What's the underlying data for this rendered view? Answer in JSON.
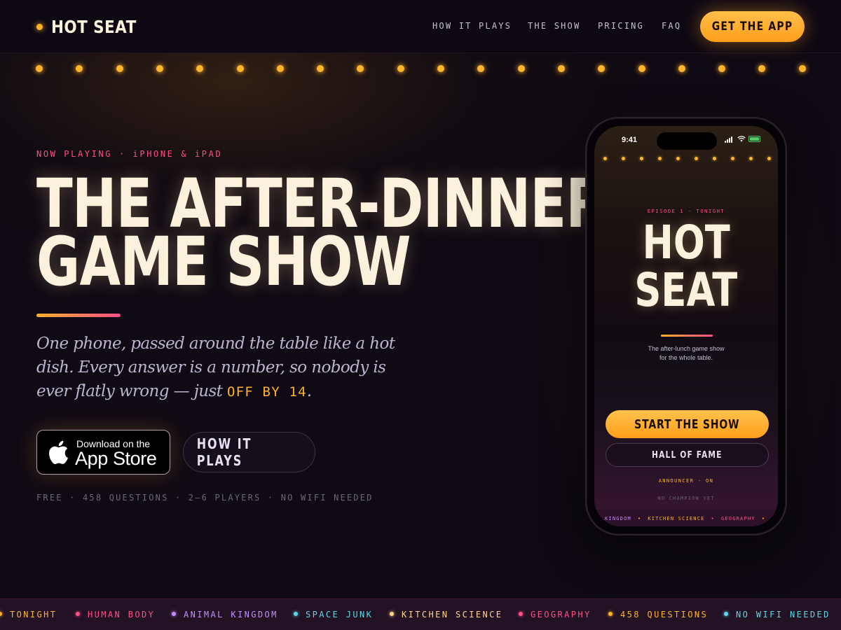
{
  "nav": {
    "brand": "HOT SEAT",
    "links": [
      "HOW IT PLAYS",
      "THE SHOW",
      "PRICING",
      "FAQ"
    ],
    "cta": "GET THE APP"
  },
  "hero": {
    "eyebrow": "NOW PLAYING · iPHONE & iPAD",
    "headline_line1": "THE AFTER-DINNER",
    "headline_line2": "GAME SHOW",
    "lede_part1": "One phone, passed around the table like a hot dish. Every answer is a number, so nobody is ever flatly wrong — just ",
    "lede_highlight": "OFF BY 14",
    "lede_end": ".",
    "appstore_small": "Download on the",
    "appstore_big": "App Store",
    "secondary_button": "HOW IT PLAYS",
    "stats": "FREE · 458 QUESTIONS · 2–6 PLAYERS · NO WIFI NEEDED"
  },
  "phone": {
    "time": "9:41",
    "eyebrow": "EPISODE 1 · TONIGHT",
    "title_line1": "HOT",
    "title_line2": "SEAT",
    "subtitle_line1": "The after-lunch game show",
    "subtitle_line2": "for the whole table.",
    "start_button": "START THE SHOW",
    "hall_button": "HALL OF FAME",
    "announcer": "ANNOUNCER · ON",
    "champion": "NO CHAMPION YET",
    "ticker": [
      {
        "label": "KINGDOM",
        "color": "#c38cff"
      },
      {
        "label": "•",
        "color": "#ffb22e"
      },
      {
        "label": "KITCHEN SCIENCE",
        "color": "#ffb22e"
      },
      {
        "label": "•",
        "color": "#ff4f86"
      },
      {
        "label": "GEOGRAPHY",
        "color": "#ff4f86"
      },
      {
        "label": "•",
        "color": "#ffb22e"
      }
    ]
  },
  "ticker": [
    {
      "label": "TONIGHT",
      "color": "#ffb22e"
    },
    {
      "label": "HUMAN BODY",
      "color": "#ff4f86"
    },
    {
      "label": "ANIMAL KINGDOM",
      "color": "#c38cff"
    },
    {
      "label": "SPACE JUNK",
      "color": "#5fd6e6"
    },
    {
      "label": "KITCHEN SCIENCE",
      "color": "#ffd58a"
    },
    {
      "label": "GEOGRAPHY",
      "color": "#ff4f86"
    },
    {
      "label": "458 QUESTIONS",
      "color": "#ffb22e"
    },
    {
      "label": "NO WIFI NEEDED",
      "color": "#5fd6e6"
    }
  ],
  "colors": {
    "accent": "#ffb22e",
    "pink": "#ff4f86",
    "background": "#0f0a13"
  }
}
